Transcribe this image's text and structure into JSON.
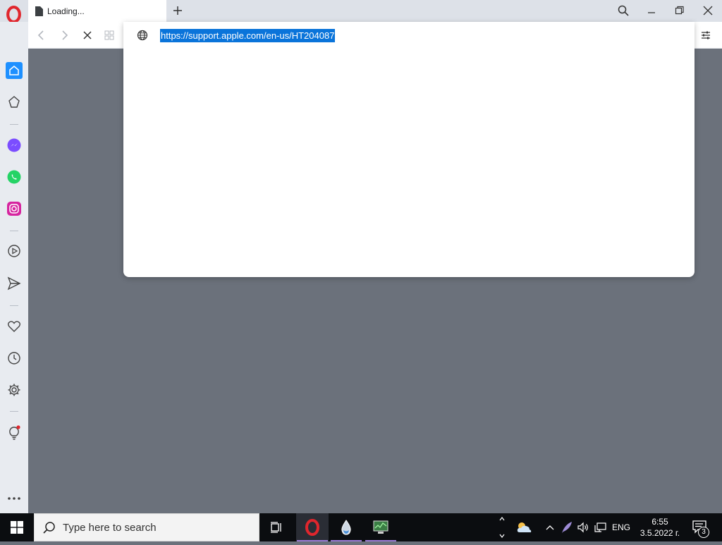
{
  "tab": {
    "title": "Loading..."
  },
  "address": {
    "url": "https://support.apple.com/en-us/HT204087"
  },
  "taskbar": {
    "search_placeholder": "Type here to search",
    "language": "ENG",
    "time": "6:55",
    "date": "3.5.2022 г.",
    "notifications": "3"
  },
  "icons": {
    "browser": "opera-logo",
    "sidebar": [
      "home-icon",
      "pinboard-icon",
      "messenger-icon",
      "whatsapp-icon",
      "instagram-icon",
      "player-icon",
      "send-icon",
      "heart-icon",
      "history-icon",
      "settings-icon",
      "tips-icon",
      "more-icon"
    ]
  },
  "colors": {
    "accent": "#0a74da",
    "opera_red": "#e0262d",
    "page_bg": "#6b717b",
    "sidebar_bg": "#e8ebf0"
  }
}
